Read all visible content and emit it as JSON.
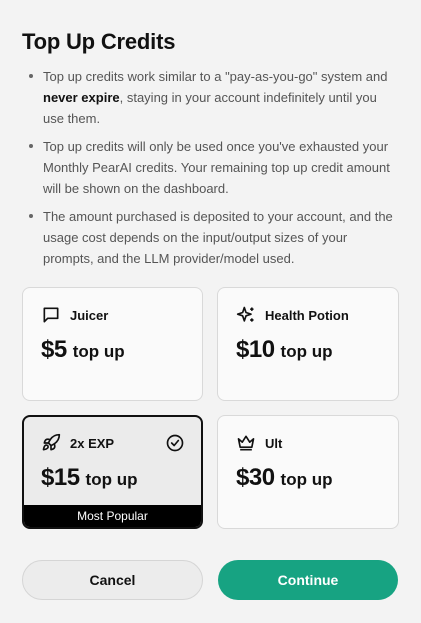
{
  "dialog": {
    "title": "Top Up Credits",
    "info": [
      {
        "pre": "Top up credits work similar to a \"pay-as-you-go\" system and ",
        "bold": "never expire",
        "post": ", staying in your account indefinitely until you use them."
      },
      {
        "pre": "Top up credits will only be used once you've exhausted your Monthly PearAI credits. Your remaining top up credit amount will be shown on the dashboard.",
        "bold": "",
        "post": ""
      },
      {
        "pre": "The amount purchased is deposited to your account, and the usage cost depends on the input/output sizes of your prompts, and the LLM provider/model used.",
        "bold": "",
        "post": ""
      }
    ]
  },
  "options": [
    {
      "name": "Juicer",
      "price": "$5",
      "suffix": "top up",
      "icon": "message-square-icon"
    },
    {
      "name": "Health Potion",
      "price": "$10",
      "suffix": "top up",
      "icon": "sparkles-icon"
    },
    {
      "name": "2x EXP",
      "price": "$15",
      "suffix": "top up",
      "icon": "rocket-icon",
      "selected": true,
      "badge": "Most Popular"
    },
    {
      "name": "Ult",
      "price": "$30",
      "suffix": "top up",
      "icon": "crown-icon"
    }
  ],
  "actions": {
    "cancel": "Cancel",
    "continue": "Continue"
  },
  "colors": {
    "accent": "#17a382",
    "background": "#f3f3f3",
    "selected_border": "#111111"
  }
}
